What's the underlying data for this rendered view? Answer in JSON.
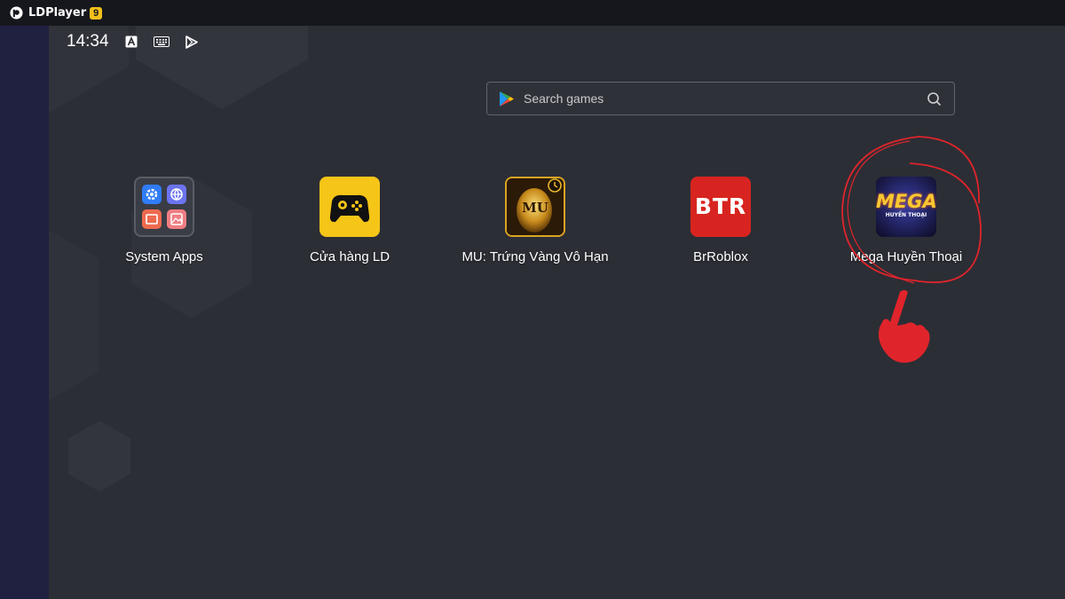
{
  "window": {
    "title": "LDPlayer",
    "version": "9"
  },
  "statusbar": {
    "time": "14:34",
    "icons": [
      "font-a-icon",
      "keyboard-icon",
      "play-store-icon"
    ]
  },
  "search": {
    "placeholder": "Search games"
  },
  "apps": [
    {
      "label": "System Apps",
      "icon": "system-apps-folder-icon"
    },
    {
      "label": "Cửa hàng LD",
      "icon": "ld-store-gamepad-icon"
    },
    {
      "label": "MU: Trứng Vàng Vô Hạn",
      "icon": "mu-golden-egg-icon",
      "icon_text": "MU"
    },
    {
      "label": "BrRoblox",
      "icon": "brroblox-icon",
      "icon_text": "BTR"
    },
    {
      "label": "Mega Huyền Thoại",
      "icon": "mega-huyen-thoai-icon",
      "icon_text": "MEGA",
      "icon_subtext": "HUYỀN THOẠI"
    }
  ],
  "colors": {
    "accent_yellow": "#f3c01a",
    "annotation_red": "#e0242b",
    "screen_bg": "#2c2e35",
    "sidebar_bg": "#202040"
  }
}
